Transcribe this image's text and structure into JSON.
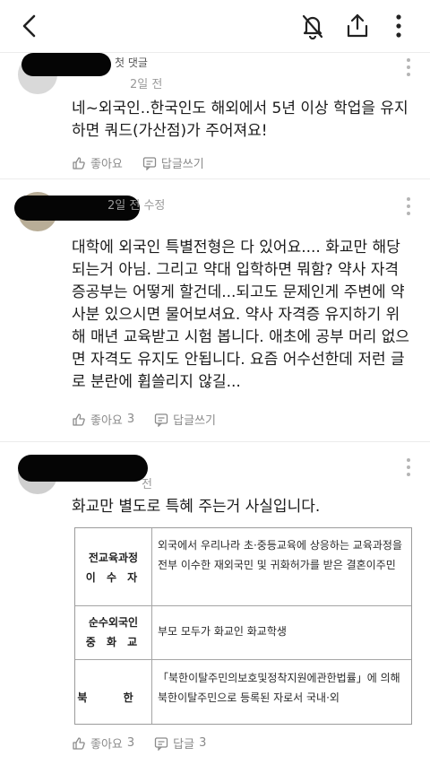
{
  "header": {
    "back_icon": "chevron-left-icon",
    "notify_off_icon": "bell-off-icon",
    "share_icon": "share-icon",
    "more_icon": "more-vertical-icon"
  },
  "comments": [
    {
      "badge": "첫 댓글",
      "meta": "2일 전",
      "text": "네~외국인..한국인도 해외에서 5년 이상 학업을 유지 하면 쿼드(가산점)가 주어져요!",
      "like_label": "좋아요",
      "like_count": "",
      "reply_label": "답글쓰기"
    },
    {
      "badge": "",
      "meta": "2일 전 수정",
      "text": "대학에 외국인 특별전형은 다 있어요.... 화교만 해당되는거 아님. 그리고 약대 입학하면 뭐함? 약사 자격증공부는 어떻게 할건데...되고도 문제인게 주변에 약사분 있으시면 물어보셔요. 약사 자격증 유지하기 위해 매년 교육받고 시험 봅니다. 애초에 공부 머리 없으면 자격도 유지도 안됩니다. 요즘 어수선한데 저런 글로 분란에 휩쓸리지 않길...",
      "like_label": "좋아요",
      "like_count": "3",
      "reply_label": "답글쓰기"
    },
    {
      "badge": "",
      "meta": "전",
      "text": "화교만 별도로 특혜 주는거 사실입니다.",
      "like_label": "좋아요",
      "like_count": "3",
      "reply_label": "답글",
      "reply_count": "3"
    }
  ],
  "table": {
    "rows": [
      {
        "header": [
          "전교육과정",
          "이 수 자"
        ],
        "content": "외국에서 우리나라 초·중등교육에 상응하는 교육과정을 전부 이수한 재외국민 및 귀화허가를 받은 결혼이주민"
      },
      {
        "header": [
          "순수외국인",
          "중 화 교"
        ],
        "content": "부모 모두가 화교인 화교학생"
      },
      {
        "header": [
          "북 한"
        ],
        "content": "「북한이탈주민의보호및정착지원에관한법률」에 의해 북한이탈주민으로 등록된 자로서 국내·외"
      }
    ]
  }
}
